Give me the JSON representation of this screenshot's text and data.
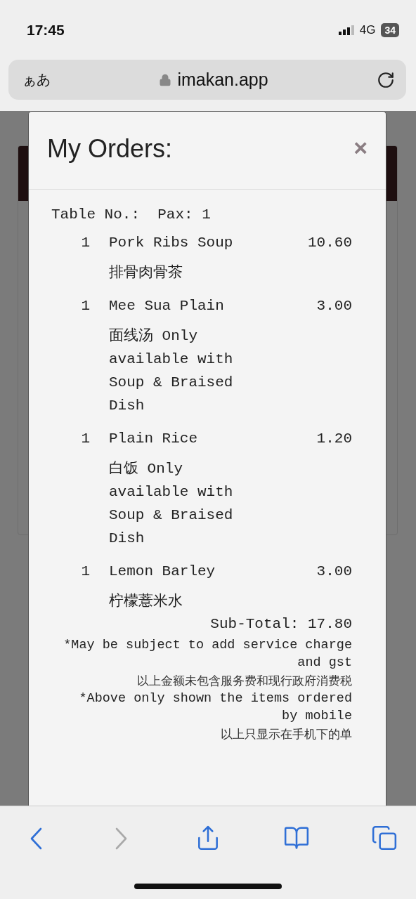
{
  "status_bar": {
    "time": "17:45",
    "network": "4G",
    "battery": "34"
  },
  "address_bar": {
    "text_size": "ぁあ",
    "url": "imakan.app"
  },
  "modal": {
    "title": "My Orders:",
    "close": "×",
    "table_line": "Table No.:  Pax: 1",
    "items": [
      {
        "qty": "1",
        "name": "Pork Ribs Soup",
        "price": "10.60",
        "description": "排骨肉骨茶"
      },
      {
        "qty": "1",
        "name": "Mee Sua Plain",
        "price": "3.00",
        "description": "面线汤 Only available with Soup & Braised Dish"
      },
      {
        "qty": "1",
        "name": "Plain Rice",
        "price": "1.20",
        "description": "白饭 Only available with Soup & Braised Dish"
      },
      {
        "qty": "1",
        "name": "Lemon Barley",
        "price": "3.00",
        "description": "柠檬薏米水"
      }
    ],
    "subtotal": "Sub-Total: 17.80",
    "notes": [
      {
        "kind": "latin",
        "text": "*May be subject to add service charge and gst"
      },
      {
        "kind": "cjk",
        "text": "以上金额未包含服务费和现行政府消费税"
      },
      {
        "kind": "latin",
        "text": "*Above only shown the items ordered by mobile"
      },
      {
        "kind": "cjk",
        "text": "以上只显示在手机下的单"
      }
    ]
  },
  "toolbar": [
    {
      "kind": "back",
      "disabled": false
    },
    {
      "kind": "forward",
      "disabled": true
    },
    {
      "kind": "share",
      "disabled": false
    },
    {
      "kind": "bookmarks",
      "disabled": false
    },
    {
      "kind": "tabs",
      "disabled": false
    }
  ]
}
